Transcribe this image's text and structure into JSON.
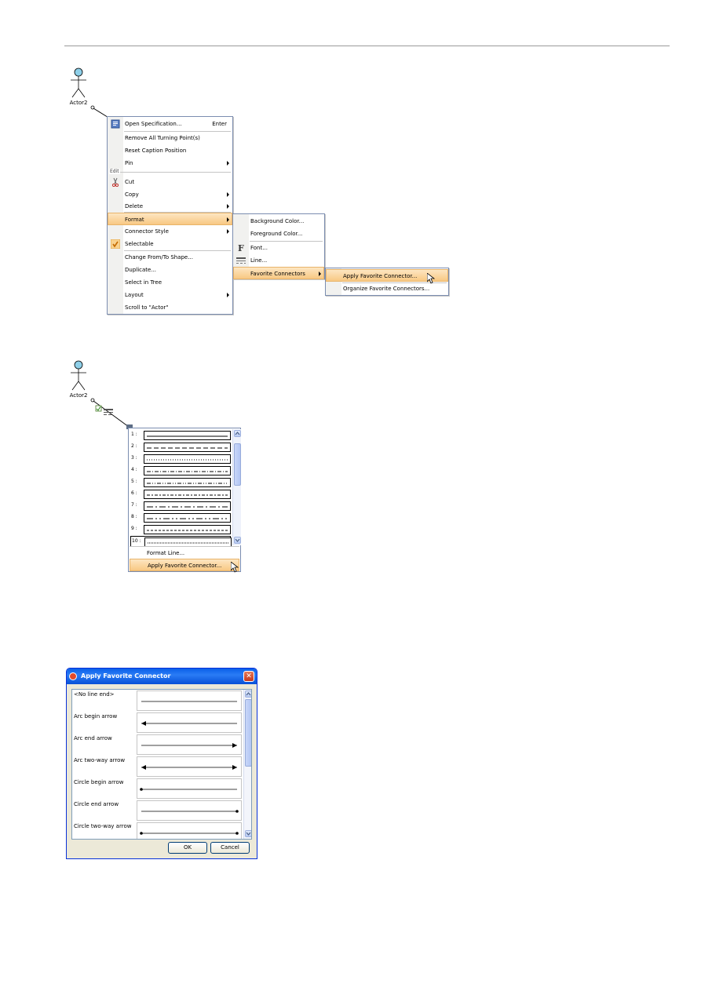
{
  "actor_top": {
    "label": "Actor2"
  },
  "actor_mid": {
    "label": "Actor2"
  },
  "context_menu": {
    "group_edit": "Edit",
    "items": [
      {
        "label": "Open Specification...",
        "shortcut": "Enter"
      },
      {
        "label": "Remove All Turning Point(s)"
      },
      {
        "label": "Reset Caption Position"
      },
      {
        "label": "Pin"
      },
      {
        "label": "Cut"
      },
      {
        "label": "Copy"
      },
      {
        "label": "Delete"
      },
      {
        "label": "Format"
      },
      {
        "label": "Connector Style"
      },
      {
        "label": "Selectable"
      },
      {
        "label": "Change From/To Shape..."
      },
      {
        "label": "Duplicate..."
      },
      {
        "label": "Select in Tree"
      },
      {
        "label": "Layout"
      },
      {
        "label": "Scroll to \"Actor\""
      }
    ]
  },
  "format_submenu": {
    "items": [
      {
        "label": "Background Color..."
      },
      {
        "label": "Foreground Color..."
      },
      {
        "label": "Font..."
      },
      {
        "label": "Line..."
      },
      {
        "label": "Favorite Connectors"
      }
    ]
  },
  "favorite_submenu": {
    "items": [
      {
        "label": "Apply Favorite Connector..."
      },
      {
        "label": "Organize Favorite Connectors..."
      }
    ]
  },
  "line_popup": {
    "rows": [
      {
        "num": "1 :",
        "dash": ""
      },
      {
        "num": "2 :",
        "dash": "6,3"
      },
      {
        "num": "3 :",
        "dash": "1,2"
      },
      {
        "num": "4 :",
        "dash": "5,2,1,2"
      },
      {
        "num": "5 :",
        "dash": "5,2,1,2,1,2"
      },
      {
        "num": "6 :",
        "dash": "4,2,2,2"
      },
      {
        "num": "7 :",
        "dash": "8,3,2,3"
      },
      {
        "num": "8 :",
        "dash": "8,3,2,3,2,3"
      },
      {
        "num": "9 :",
        "dash": "3,2"
      },
      {
        "num": "10 :",
        "dash": "1,1"
      }
    ],
    "format_line": "Format Line...",
    "apply": "Apply Favorite Connector..."
  },
  "dialog": {
    "title": "Apply Favorite Connector",
    "rows": [
      {
        "label": "<No line end>",
        "start": "none",
        "end": "none"
      },
      {
        "label": "Arc begin arrow",
        "start": "arrow",
        "end": "none"
      },
      {
        "label": "Arc end arrow",
        "start": "none",
        "end": "arrow"
      },
      {
        "label": "Arc two-way arrow",
        "start": "arrow",
        "end": "arrow"
      },
      {
        "label": "Circle begin arrow",
        "start": "dot",
        "end": "none"
      },
      {
        "label": "Circle end arrow",
        "start": "none",
        "end": "dot"
      },
      {
        "label": "Circle two-way arrow",
        "start": "dot",
        "end": "dot"
      }
    ],
    "ok": "OK",
    "cancel": "Cancel"
  },
  "colors": {
    "menu_highlight": "#f8c883",
    "menu_border": "#7b8db0",
    "actor_head": "#8ecfe8",
    "xp_title": "#0a5fe8"
  }
}
